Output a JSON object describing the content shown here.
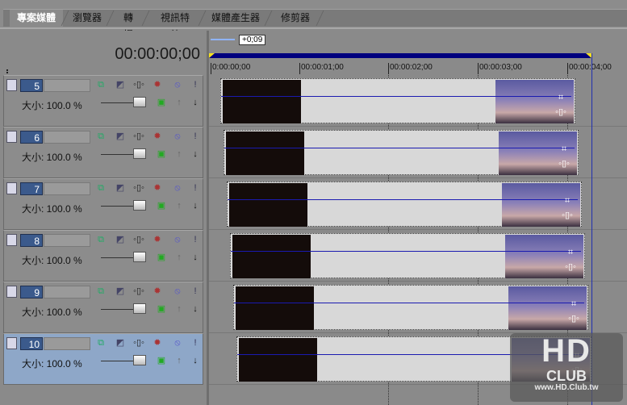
{
  "tabs": [
    {
      "label": "專案媒體",
      "active": true
    },
    {
      "label": "瀏覽器"
    },
    {
      "label": "轉場"
    },
    {
      "label": "視訊特效"
    },
    {
      "label": "媒體產生器"
    },
    {
      "label": "修剪器"
    }
  ],
  "timecode": "00:00:00;00",
  "offset": "+0;09",
  "ruler": [
    "0:00:00;00",
    "00:00:01;00",
    "00:00:02;00",
    "00:00:03;00",
    "00:00:04;00"
  ],
  "tracks": [
    {
      "number": "5",
      "size": "大小: 100.0 %"
    },
    {
      "number": "6",
      "size": "大小: 100.0 %"
    },
    {
      "number": "7",
      "size": "大小: 100.0 %"
    },
    {
      "number": "8",
      "size": "大小: 100.0 %"
    },
    {
      "number": "9",
      "size": "大小: 100.0 %"
    },
    {
      "number": "10",
      "size": "大小: 100.0 %",
      "selected": true
    }
  ],
  "watermark": {
    "big": "HD",
    "club": "CLUB",
    "url": "www.HD.Club.tw"
  },
  "colors": {
    "track_number": "#3b5a8c",
    "loop_bar": "#00007e",
    "selected_track": "#8ea7c8"
  }
}
